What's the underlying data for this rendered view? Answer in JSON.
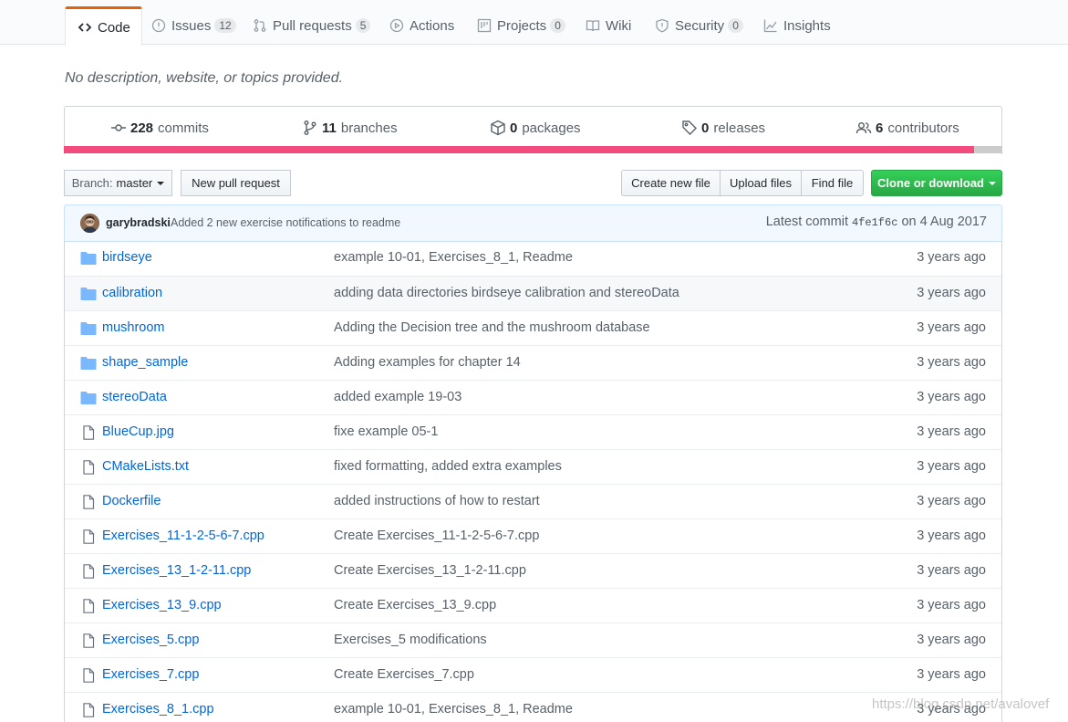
{
  "tabs": [
    {
      "label": "Code",
      "icon": "code-icon",
      "count": null,
      "selected": true
    },
    {
      "label": "Issues",
      "icon": "issue-icon",
      "count": "12"
    },
    {
      "label": "Pull requests",
      "icon": "pull-request-icon",
      "count": "5"
    },
    {
      "label": "Actions",
      "icon": "play-icon",
      "count": null
    },
    {
      "label": "Projects",
      "icon": "project-icon",
      "count": "0"
    },
    {
      "label": "Wiki",
      "icon": "book-icon",
      "count": null
    },
    {
      "label": "Security",
      "icon": "shield-icon",
      "count": "0"
    },
    {
      "label": "Insights",
      "icon": "graph-icon",
      "count": null
    }
  ],
  "description": "No description, website, or topics provided.",
  "summary": {
    "commits": {
      "count": "228",
      "label": "commits"
    },
    "branches": {
      "count": "11",
      "label": "branches"
    },
    "packages": {
      "count": "0",
      "label": "packages"
    },
    "releases": {
      "count": "0",
      "label": "releases"
    },
    "contributors": {
      "count": "6",
      "label": "contributors"
    }
  },
  "language_bar": {
    "primary_color": "#f34b7d",
    "secondary_color": "#cccccc",
    "primary_fraction": 0.97
  },
  "toolbar": {
    "branch_prefix": "Branch:",
    "branch_name": "master",
    "new_pr": "New pull request",
    "create_file": "Create new file",
    "upload_files": "Upload files",
    "find_file": "Find file",
    "clone": "Clone or download"
  },
  "latest_commit": {
    "author": "garybradski",
    "message": "Added 2 new exercise notifications to readme",
    "prefix": "Latest commit",
    "sha": "4fe1f6c",
    "date": "on 4 Aug 2017"
  },
  "files": [
    {
      "type": "dir",
      "name": "birdseye",
      "message": "example 10-01, Exercises_8_1, Readme",
      "age": "3 years ago"
    },
    {
      "type": "dir",
      "name": "calibration",
      "message": "adding data directories birdseye calibration and stereoData",
      "age": "3 years ago"
    },
    {
      "type": "dir",
      "name": "mushroom",
      "message": "Adding the Decision tree and the mushroom database",
      "age": "3 years ago"
    },
    {
      "type": "dir",
      "name": "shape_sample",
      "message": "Adding examples for chapter 14",
      "age": "3 years ago"
    },
    {
      "type": "dir",
      "name": "stereoData",
      "message": "added example 19-03",
      "age": "3 years ago"
    },
    {
      "type": "file",
      "name": "BlueCup.jpg",
      "message": "fixe example 05-1",
      "age": "3 years ago"
    },
    {
      "type": "file",
      "name": "CMakeLists.txt",
      "message": "fixed formatting, added extra examples",
      "age": "3 years ago"
    },
    {
      "type": "file",
      "name": "Dockerfile",
      "message": "added instructions of how to restart",
      "age": "3 years ago"
    },
    {
      "type": "file",
      "name": "Exercises_11-1-2-5-6-7.cpp",
      "message": "Create Exercises_11-1-2-5-6-7.cpp",
      "age": "3 years ago"
    },
    {
      "type": "file",
      "name": "Exercises_13_1-2-11.cpp",
      "message": "Create Exercises_13_1-2-11.cpp",
      "age": "3 years ago"
    },
    {
      "type": "file",
      "name": "Exercises_13_9.cpp",
      "message": "Create Exercises_13_9.cpp",
      "age": "3 years ago"
    },
    {
      "type": "file",
      "name": "Exercises_5.cpp",
      "message": "Exercises_5 modifications",
      "age": "3 years ago"
    },
    {
      "type": "file",
      "name": "Exercises_7.cpp",
      "message": "Create Exercises_7.cpp",
      "age": "3 years ago"
    },
    {
      "type": "file",
      "name": "Exercises_8_1.cpp",
      "message": "example 10-01, Exercises_8_1, Readme",
      "age": "3 years ago"
    }
  ],
  "watermark": "https://blog.csdn.net/avalovef"
}
